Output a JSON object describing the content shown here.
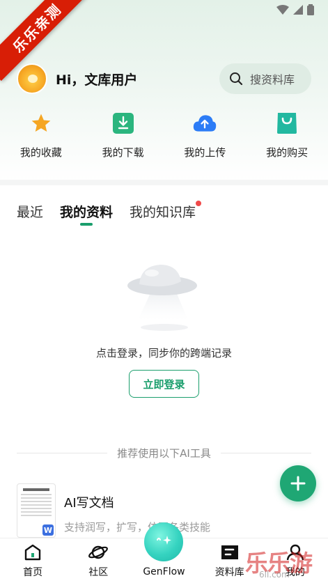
{
  "ribbon": "乐乐亲测",
  "header": {
    "greeting": "Hi，文库用户",
    "search_label": "搜资料库"
  },
  "quick_actions": [
    {
      "label": "我的收藏",
      "icon": "star-icon",
      "color": "#f5a623"
    },
    {
      "label": "我的下载",
      "icon": "download-icon",
      "color": "#2bb57e"
    },
    {
      "label": "我的上传",
      "icon": "upload-cloud-icon",
      "color": "#2c7cf6"
    },
    {
      "label": "我的购买",
      "icon": "shopping-bag-icon",
      "color": "#22b8a0"
    }
  ],
  "tabs": [
    {
      "label": "最近"
    },
    {
      "label": "我的资料",
      "active": true
    },
    {
      "label": "我的知识库",
      "badge": true
    }
  ],
  "empty_state": {
    "text": "点击登录，同步你的跨端记录",
    "button": "立即登录"
  },
  "ai_section": {
    "separator": "推荐使用以下AI工具",
    "card": {
      "title": "AI写文档",
      "desc": "支持润写，扩写，仿写各类技能",
      "thumb_title": "好好学习天天向上"
    }
  },
  "bottom_nav": [
    {
      "label": "首页",
      "icon": "home-icon"
    },
    {
      "label": "社区",
      "icon": "planet-icon"
    },
    {
      "label": "GenFlow",
      "icon": "genflow-orb-icon"
    },
    {
      "label": "资料库",
      "icon": "library-icon"
    },
    {
      "label": "我的",
      "icon": "user-icon"
    }
  ],
  "watermark": {
    "text": "乐乐游戏",
    "sub": "6ll.com"
  },
  "colors": {
    "accent": "#1a9e6c",
    "fab": "#1fa774",
    "badge": "#f04a4a"
  }
}
